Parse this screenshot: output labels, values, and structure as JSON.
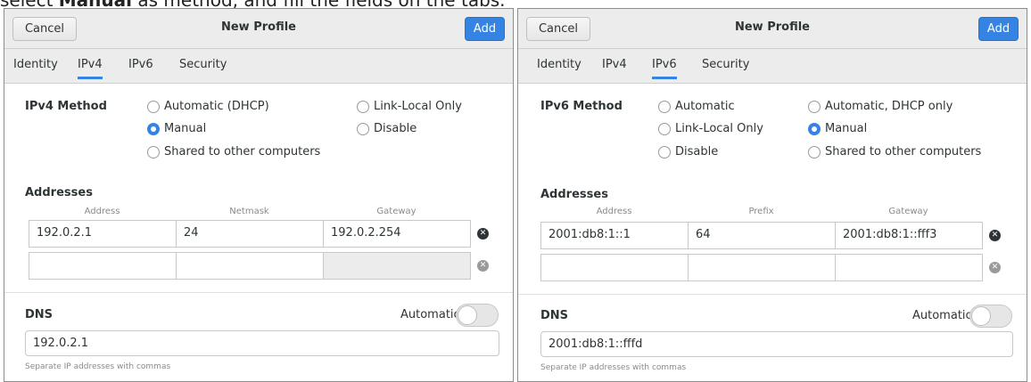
{
  "caption": {
    "prefix": "select ",
    "bold": "Manual",
    "suffix": " as method, and fill the fields on the tabs."
  },
  "left": {
    "header": {
      "cancel": "Cancel",
      "title": "New Profile",
      "add": "Add"
    },
    "tabs": [
      {
        "label": "Identity",
        "active": false
      },
      {
        "label": "IPv4",
        "active": true
      },
      {
        "label": "IPv6",
        "active": false
      },
      {
        "label": "Security",
        "active": false
      }
    ],
    "method_label": "IPv4 Method",
    "methods": [
      {
        "label": "Automatic (DHCP)",
        "selected": false
      },
      {
        "label": "Link-Local Only",
        "selected": false
      },
      {
        "label": "Manual",
        "selected": true
      },
      {
        "label": "Disable",
        "selected": false
      },
      {
        "label": "Shared to other computers",
        "selected": false
      }
    ],
    "addresses_label": "Addresses",
    "columns": [
      "Address",
      "Netmask",
      "Gateway"
    ],
    "rows": [
      [
        "192.0.2.1",
        "24",
        "192.0.2.254"
      ],
      [
        "",
        "",
        ""
      ]
    ],
    "dns_label": "DNS",
    "dns_auto_label": "Automatic",
    "dns_value": "192.0.2.1",
    "dns_hint": "Separate IP addresses with commas"
  },
  "right": {
    "header": {
      "cancel": "Cancel",
      "title": "New Profile",
      "add": "Add"
    },
    "tabs": [
      {
        "label": "Identity",
        "active": false
      },
      {
        "label": "IPv4",
        "active": false
      },
      {
        "label": "IPv6",
        "active": true
      },
      {
        "label": "Security",
        "active": false
      }
    ],
    "method_label": "IPv6 Method",
    "methods": [
      {
        "label": "Automatic",
        "selected": false
      },
      {
        "label": "Automatic, DHCP only",
        "selected": false
      },
      {
        "label": "Link-Local Only",
        "selected": false
      },
      {
        "label": "Manual",
        "selected": true
      },
      {
        "label": "Disable",
        "selected": false
      },
      {
        "label": "Shared to other computers",
        "selected": false
      }
    ],
    "addresses_label": "Addresses",
    "columns": [
      "Address",
      "Prefix",
      "Gateway"
    ],
    "rows": [
      [
        "2001:db8:1::1",
        "64",
        "2001:db8:1::fff3"
      ],
      [
        "",
        "",
        ""
      ]
    ],
    "dns_label": "DNS",
    "dns_auto_label": "Automatic",
    "dns_value": "2001:db8:1::fffd",
    "dns_hint": "Separate IP addresses with commas"
  },
  "colors": {
    "accent": "#3584e4",
    "header_bg": "#ececec"
  }
}
